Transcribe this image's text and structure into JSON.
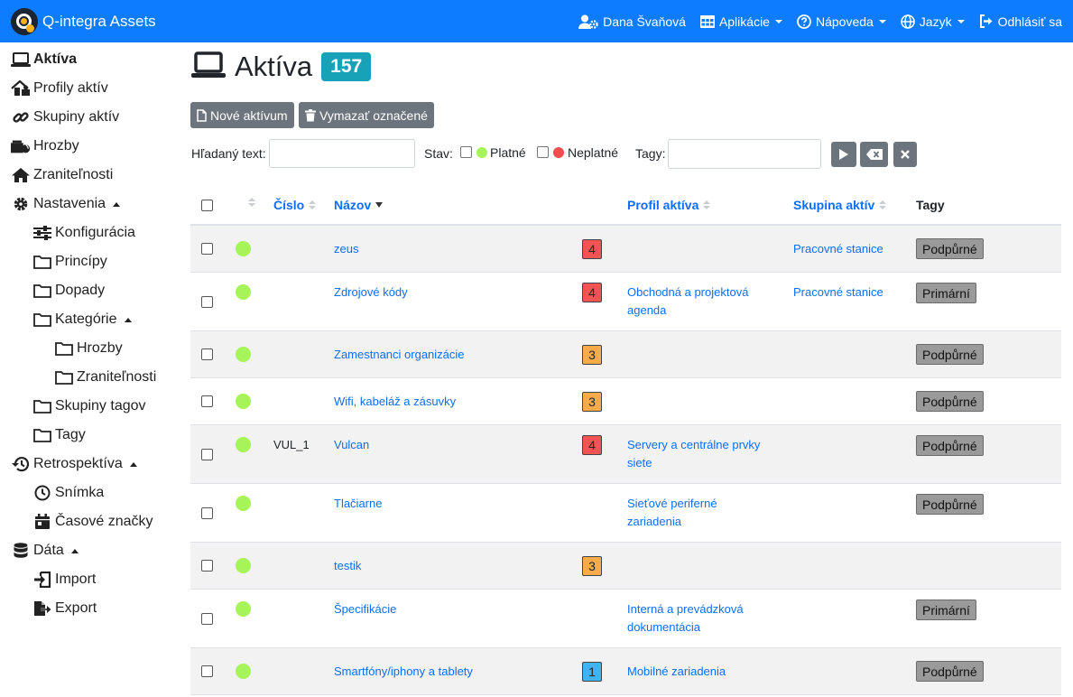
{
  "navbar": {
    "brand": "Q-integra Assets",
    "user": "Dana Švaňová",
    "apps": "Aplikácie",
    "help": "Nápoveda",
    "language": "Jazyk",
    "logout": "Odhlásiť sa",
    "color": "#0d7cff"
  },
  "sidebar": {
    "assets": "Aktíva",
    "profiles": "Profily aktív",
    "groups": "Skupiny aktív",
    "threats": "Hrozby",
    "vulnerabilities": "Zraniteľnosti",
    "settings": "Nastavenia",
    "configuration": "Konfigurácia",
    "principles": "Princípy",
    "impacts": "Dopady",
    "categories": "Kategórie",
    "cat_threats": "Hrozby",
    "cat_vulnerabilities": "Zraniteľnosti",
    "tag_groups": "Skupiny tagov",
    "tags": "Tagy",
    "retrospective": "Retrospektíva",
    "snapshot": "Snímka",
    "timestamps": "Časové značky",
    "data": "Dáta",
    "import": "Import",
    "export": "Export"
  },
  "page": {
    "title": "Aktíva",
    "count": "157",
    "new_button": "Nové aktívum",
    "delete_button": "Vymazať označené"
  },
  "filters": {
    "search_label": "Hľadaný text:",
    "search_value": "",
    "status_label": "Stav:",
    "valid_label": "Platné",
    "invalid_label": "Neplatné",
    "tags_label": "Tagy:",
    "tags_value": "",
    "valid_color": "#a6f35a",
    "invalid_color": "#f24e4e"
  },
  "table": {
    "headers": {
      "number": "Číslo",
      "name": "Názov",
      "profile": "Profil aktíva",
      "group": "Skupina aktív",
      "tags": "Tagy"
    },
    "level_colors": {
      "4": "#f25454",
      "3": "#f9aa4a",
      "1": "#3fb3f5"
    },
    "rows": [
      {
        "number": "",
        "name": "zeus",
        "level": "4",
        "profile_line1": "",
        "profile_line2": "",
        "group": "Pracovné stanice",
        "tag": "Podpůrné"
      },
      {
        "number": "",
        "name": "Zdrojové kódy",
        "level": "4",
        "profile_line1": "Obchodná a projektová",
        "profile_line2": "agenda",
        "group": "Pracovné stanice",
        "tag": "Primární"
      },
      {
        "number": "",
        "name": "Zamestnanci organizácie",
        "level": "3",
        "profile_line1": "",
        "profile_line2": "",
        "group": "",
        "tag": "Podpůrné"
      },
      {
        "number": "",
        "name": "Wifi, kabeláž a zásuvky",
        "level": "3",
        "profile_line1": "",
        "profile_line2": "",
        "group": "",
        "tag": "Podpůrné"
      },
      {
        "number": "VUL_1",
        "name": "Vulcan",
        "level": "4",
        "profile_line1": "Servery a centrálne prvky",
        "profile_line2": "siete",
        "group": "",
        "tag": "Podpůrné"
      },
      {
        "number": "",
        "name": "Tlačiarne",
        "level": "",
        "profile_line1": "Sieťové periferné",
        "profile_line2": "zariadenia",
        "group": "",
        "tag": "Podpůrné"
      },
      {
        "number": "",
        "name": "testik",
        "level": "3",
        "profile_line1": "",
        "profile_line2": "",
        "group": "",
        "tag": ""
      },
      {
        "number": "",
        "name": "Špecifikácie",
        "level": "",
        "profile_line1": "Interná a prevádzková",
        "profile_line2": "dokumentácia",
        "group": "",
        "tag": "Primární"
      },
      {
        "number": "",
        "name": "Smartfóny/iphony a tablety",
        "level": "1",
        "profile_line1": "Mobilné zariadenia",
        "profile_line2": "",
        "group": "",
        "tag": "Podpůrné"
      }
    ]
  }
}
